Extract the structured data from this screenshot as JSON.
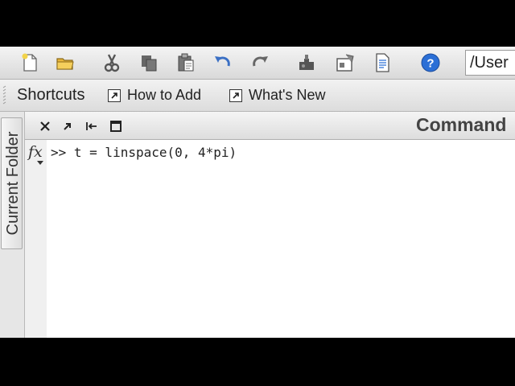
{
  "toolbar": {
    "icons": [
      "new-file-icon",
      "open-folder-icon",
      "cut-icon",
      "copy-icon",
      "paste-icon",
      "undo-icon",
      "redo-icon",
      "simulink-icon",
      "guide-icon",
      "profiler-icon",
      "help-icon"
    ],
    "path_value": "/User"
  },
  "shortcuts": {
    "label": "Shortcuts",
    "links": [
      {
        "label": "How to Add"
      },
      {
        "label": "What's New"
      }
    ]
  },
  "side_tab": {
    "label": "Current Folder"
  },
  "command_window": {
    "title": "Command",
    "prompt_line": ">> t = linspace(0, 4*pi)",
    "fx_label": "fx"
  },
  "colors": {
    "help_blue": "#2b6fd6",
    "undo_blue": "#3a6fc4",
    "folder_yellow": "#e8b53a",
    "background_black": "#000000"
  }
}
